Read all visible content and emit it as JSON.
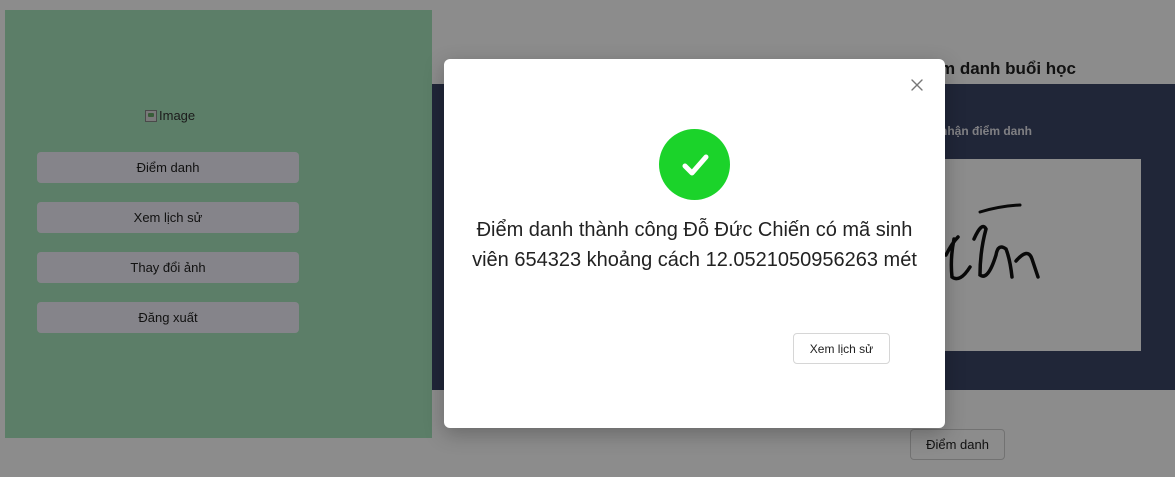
{
  "sidebar": {
    "image_alt": "Image",
    "items": [
      {
        "label": "Điểm danh"
      },
      {
        "label": "Xem lịch sử"
      },
      {
        "label": "Thay đổi ảnh"
      },
      {
        "label": "Đăng xuất"
      }
    ]
  },
  "main": {
    "title": "m danh buổi học",
    "card_label": "nhận điểm danh",
    "submit_label": "Điểm danh"
  },
  "modal": {
    "icon": "check-circle-icon",
    "message": "Điểm danh thành công Đỗ Đức Chiến có mã sinh viên 654323 khoảng cách 12.0521050956263 mét",
    "action_label": "Xem lịch sử"
  },
  "colors": {
    "sidebar_bg": "#a8e6bd",
    "card_bg": "#3b4566",
    "success": "#1bd32a"
  }
}
